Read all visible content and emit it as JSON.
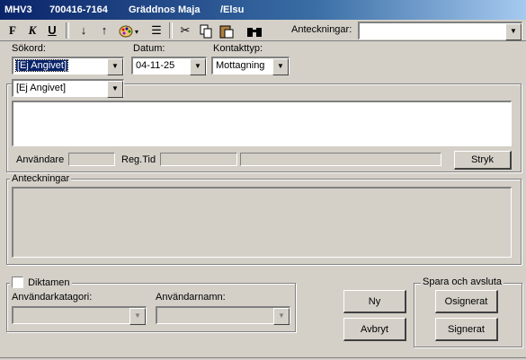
{
  "title": {
    "module": "MHV3",
    "patient_id": "700416-7164",
    "patient_name": "Gräddnos Maja",
    "user": "/Elsu"
  },
  "toolbar": {
    "bold_icon": "bold-icon",
    "italic_icon": "italic-icon",
    "underline_icon": "underline-icon",
    "move_down_icon": "arrow-down-icon",
    "move_up_icon": "arrow-up-icon",
    "color_icon": "palette-icon",
    "list_icon": "list-icon",
    "cut_icon": "cut-icon",
    "copy_icon": "copy-icon",
    "paste_icon": "paste-icon",
    "find_icon": "binoculars-icon",
    "notes_label": "Anteckningar:",
    "notes_value": ""
  },
  "search": {
    "keyword_label": "Sökord:",
    "keyword_value": "[Ej Angivet]",
    "date_label": "Datum:",
    "date_value": "04-11-25",
    "contact_label": "Kontakttyp:",
    "contact_value": "Mottagning"
  },
  "entry": {
    "keyword_value": "[Ej Angivet]",
    "text": "",
    "user_label": "Användare",
    "user_value": "",
    "regtime_label": "Reg.Tid",
    "regtime_value": "",
    "extra_value": "",
    "strike_button": "Stryk"
  },
  "notes": {
    "group_label": "Anteckningar",
    "text": ""
  },
  "dictation": {
    "label": "Diktamen",
    "checked": false,
    "category_label": "Användarkatagori:",
    "category_value": "",
    "username_label": "Användarnamn:",
    "username_value": ""
  },
  "actions": {
    "new_button": "Ny",
    "cancel_button": "Avbryt"
  },
  "save": {
    "group_label": "Spara och avsluta",
    "unsigned_button": "Osignerat",
    "signed_button": "Signerat"
  }
}
